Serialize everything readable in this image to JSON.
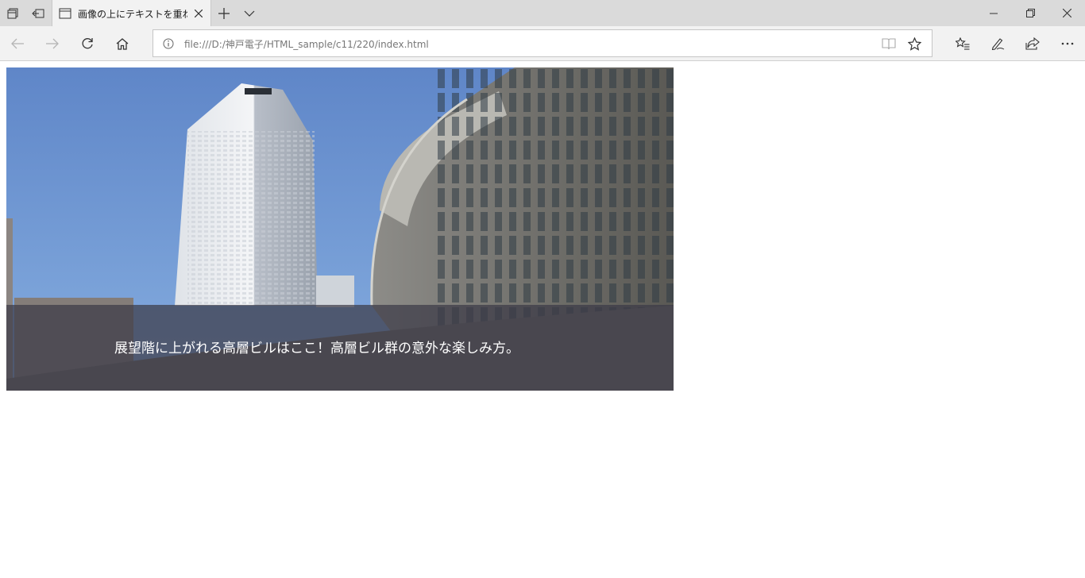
{
  "browser": {
    "tab": {
      "title": "画像の上にテキストを重ねる"
    },
    "address": {
      "url": "file:///D:/神戸電子/HTML_sample/c11/220/index.html"
    },
    "icons": {
      "tab_actions": "tabs-icon",
      "set_aside": "set-aside-icon",
      "new_tab": "plus-icon",
      "tab_list": "chevron-down-icon",
      "minimize": "minimize-icon",
      "restore": "restore-icon",
      "close": "close-icon",
      "back": "back-arrow-icon",
      "forward": "forward-arrow-icon",
      "refresh": "refresh-icon",
      "home": "home-icon",
      "site_info": "info-icon",
      "reading_view": "book-icon",
      "favorite": "star-icon",
      "favorites_hub": "favorites-list-icon",
      "notes": "pen-icon",
      "share": "share-icon",
      "more": "more-icon"
    }
  },
  "page": {
    "caption": "展望階に上がれる高層ビルはここ！高層ビル群の意外な楽しみ方。"
  },
  "colors": {
    "tabbar": "#dadada",
    "navbar": "#f2f2f2",
    "sky": "#6a90d0",
    "caption_overlay": "rgba(60,58,70,0.72)"
  }
}
